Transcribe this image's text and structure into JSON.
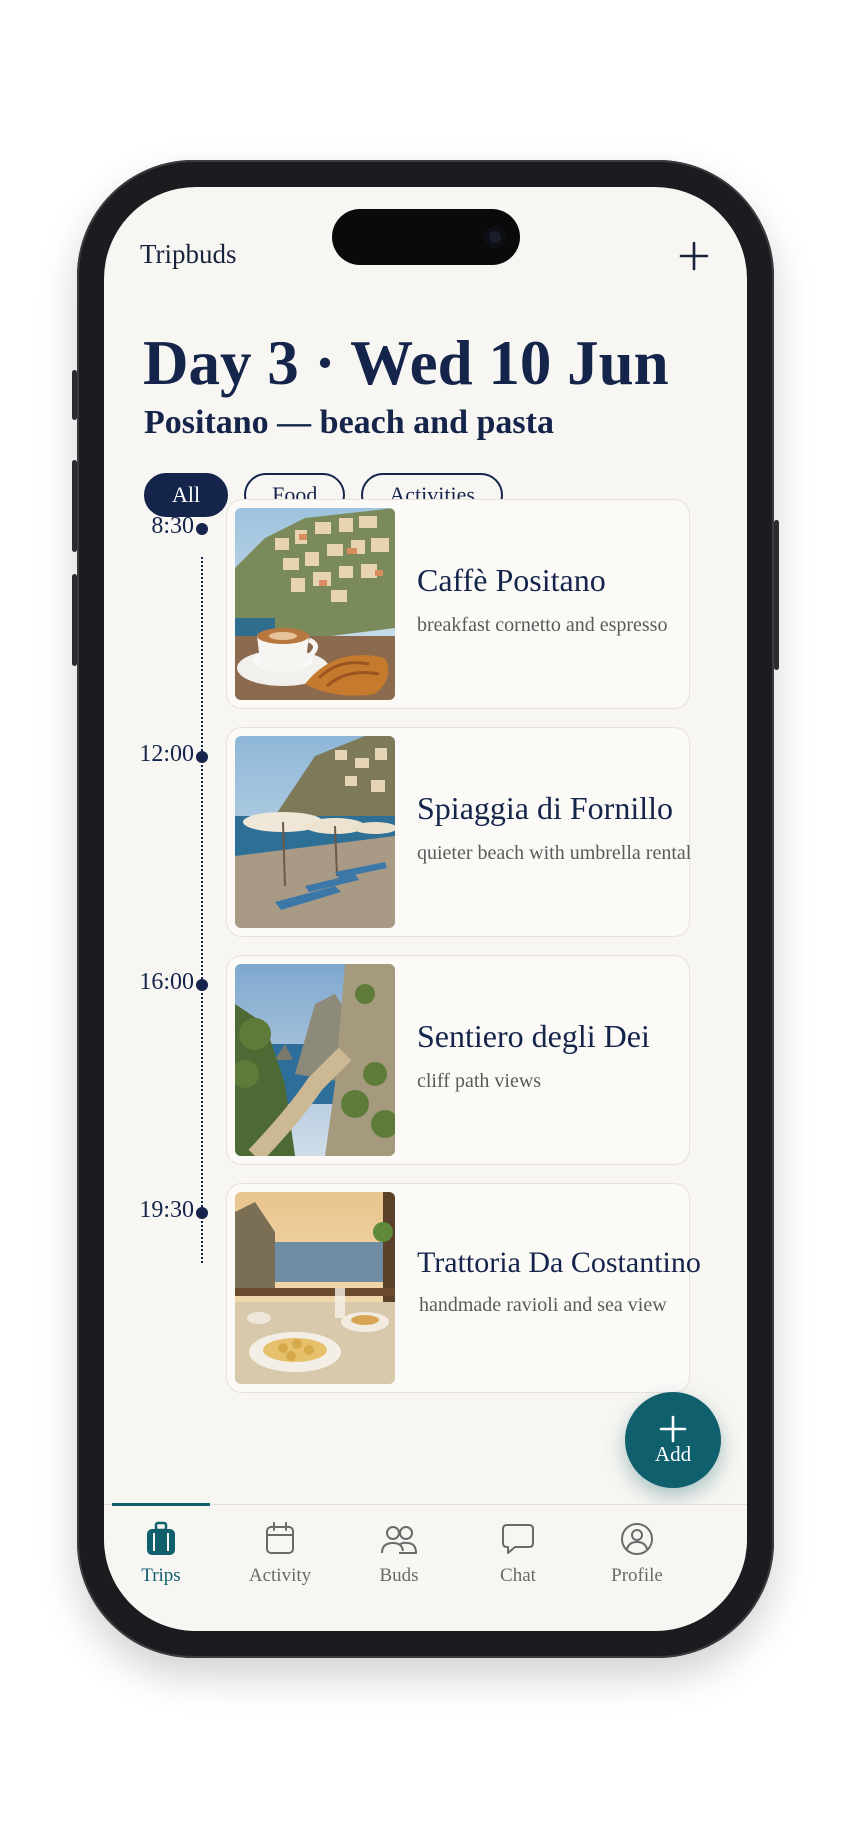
{
  "app": {
    "name": "Tripbuds",
    "add_icon": "plus-icon"
  },
  "header": {
    "title": "Day 3 · Wed 10 Jun",
    "subtitle": "Positano — beach and pasta"
  },
  "filters": {
    "selected": "All",
    "items": [
      "All",
      "Food",
      "Activities"
    ]
  },
  "itinerary": [
    {
      "time": "8:30",
      "name": "Caffè Positano",
      "desc": "breakfast cornetto and espresso",
      "photo": "coffee-croissant-positano-photo"
    },
    {
      "time": "12:00",
      "name": "Spiaggia di Fornillo",
      "desc": "quieter beach with umbrella rental",
      "photo": "beach-umbrellas-photo"
    },
    {
      "time": "16:00",
      "name": "Sentiero degli Dei",
      "desc": "cliff path views",
      "photo": "cliff-path-photo"
    },
    {
      "time": "19:30",
      "name": "Trattoria Da Costantino",
      "desc": "handmade ravioli and sea view",
      "photo": "ravioli-sea-view-photo"
    }
  ],
  "fab": {
    "label": "Add",
    "icon": "plus-icon"
  },
  "tabbar": {
    "active": "Trips",
    "items": [
      {
        "label": "Trips",
        "icon": "suitcase-icon"
      },
      {
        "label": "Activity",
        "icon": "calendar-icon"
      },
      {
        "label": "Buds",
        "icon": "people-icon"
      },
      {
        "label": "Chat",
        "icon": "chat-bubble-icon"
      },
      {
        "label": "Profile",
        "icon": "profile-icon"
      }
    ]
  },
  "colors": {
    "navy": "#14244a",
    "teal": "#0f5f6d",
    "background": "#f8f6f2"
  }
}
